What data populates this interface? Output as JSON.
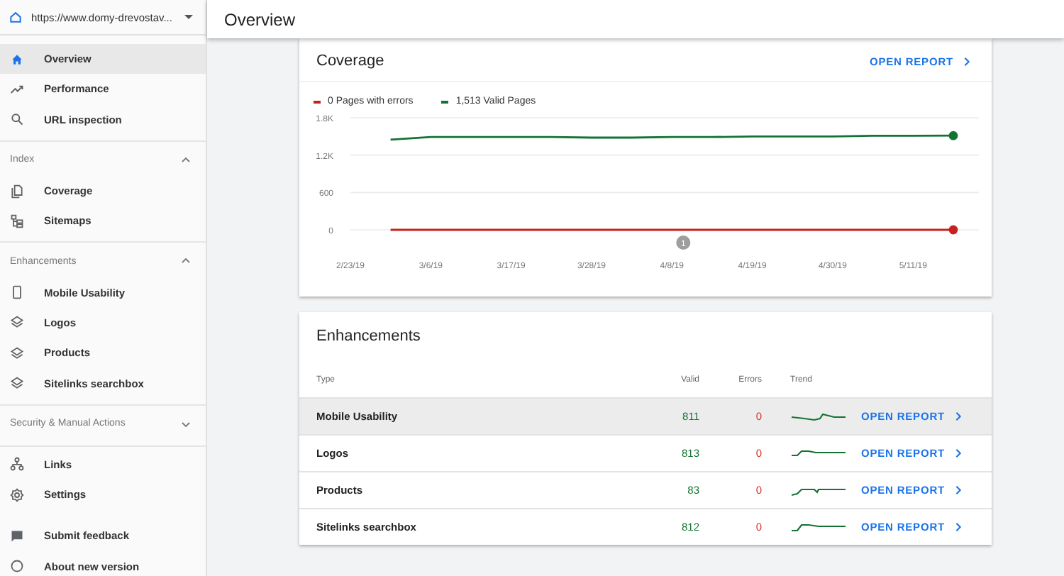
{
  "property": {
    "url": "https://www.domy-drevostav..."
  },
  "header": {
    "title": "Overview"
  },
  "sidebar": {
    "top_items": [
      {
        "label": "Overview",
        "selected": true
      },
      {
        "label": "Performance",
        "selected": false
      },
      {
        "label": "URL inspection",
        "selected": false
      }
    ],
    "sections": [
      {
        "title": "Index",
        "expanded": true,
        "items": [
          {
            "label": "Coverage",
            "selected": false
          },
          {
            "label": "Sitemaps",
            "selected": false
          }
        ]
      },
      {
        "title": "Enhancements",
        "expanded": true,
        "items": [
          {
            "label": "Mobile Usability",
            "selected": false
          },
          {
            "label": "Logos",
            "selected": false
          },
          {
            "label": "Products",
            "selected": false
          },
          {
            "label": "Sitelinks searchbox",
            "selected": false
          }
        ]
      },
      {
        "title": "Security & Manual Actions",
        "expanded": false
      }
    ],
    "bottom_items": [
      {
        "label": "Links",
        "selected": false
      },
      {
        "label": "Settings",
        "selected": false
      }
    ],
    "footer_items": [
      {
        "label": "Submit feedback"
      },
      {
        "label": "About new version"
      }
    ]
  },
  "coverage": {
    "title": "Coverage",
    "open_report": "OPEN REPORT",
    "chart_data": {
      "type": "line",
      "categories": [
        "2/23/19",
        null,
        "3/6/19",
        null,
        "3/17/19",
        null,
        "3/28/19",
        null,
        "4/8/19",
        null,
        "4/19/19",
        null,
        "4/30/19",
        null,
        "5/11/19",
        null
      ],
      "series": [
        {
          "name": "0 Pages with errors",
          "color": "#c5221f",
          "values": [
            null,
            0,
            0,
            0,
            0,
            0,
            0,
            0,
            0,
            0,
            0,
            0,
            0,
            0,
            0,
            0
          ]
        },
        {
          "name": "1,513 Valid Pages",
          "color": "#137333",
          "values": [
            null,
            1450,
            1490,
            1490,
            1490,
            1490,
            1480,
            1480,
            1490,
            1490,
            1500,
            1500,
            1500,
            1510,
            1510,
            1513
          ]
        }
      ],
      "ylim": [
        0,
        1800
      ],
      "yticks": [
        {
          "value": 0,
          "label": "0"
        },
        {
          "value": 600,
          "label": "600"
        },
        {
          "value": 1200,
          "label": "1.2K"
        },
        {
          "value": 1800,
          "label": "1.8K"
        }
      ],
      "annotations": [
        "1"
      ]
    }
  },
  "enhancements": {
    "title": "Enhancements",
    "columns": [
      "Type",
      "Valid",
      "Errors",
      "Trend"
    ],
    "rows": [
      {
        "type": "Mobile Usability",
        "valid": "811",
        "errors": "0",
        "action": "OPEN REPORT",
        "selected": true
      },
      {
        "type": "Logos",
        "valid": "813",
        "errors": "0",
        "action": "OPEN REPORT",
        "selected": false
      },
      {
        "type": "Products",
        "valid": "83",
        "errors": "0",
        "action": "OPEN REPORT",
        "selected": false
      },
      {
        "type": "Sitelinks searchbox",
        "valid": "812",
        "errors": "0",
        "action": "OPEN REPORT",
        "selected": false
      }
    ]
  }
}
